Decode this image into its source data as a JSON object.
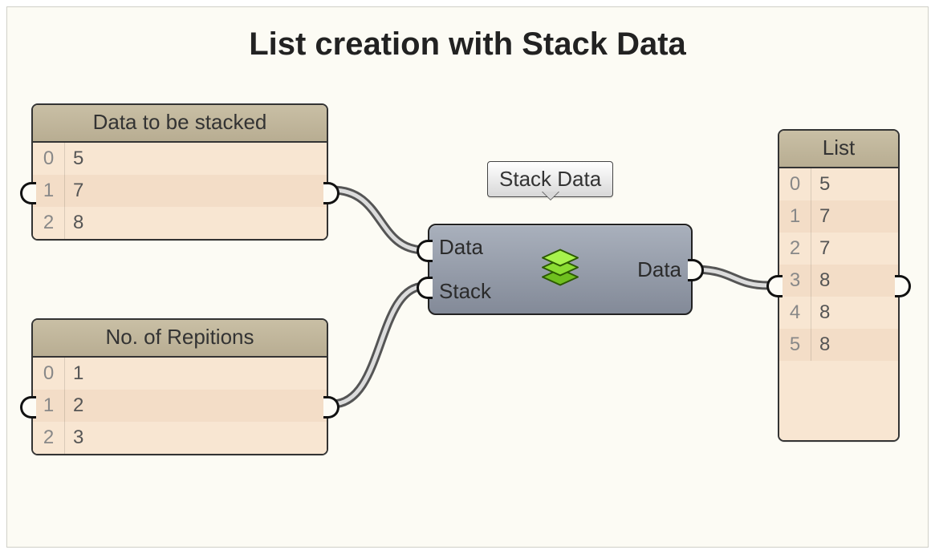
{
  "title": "List creation with Stack Data",
  "panels": {
    "data": {
      "title": "Data to be stacked",
      "rows": [
        {
          "idx": "0",
          "val": "5"
        },
        {
          "idx": "1",
          "val": "7"
        },
        {
          "idx": "2",
          "val": "8"
        }
      ]
    },
    "reps": {
      "title": "No. of Repitions",
      "rows": [
        {
          "idx": "0",
          "val": "1"
        },
        {
          "idx": "1",
          "val": "2"
        },
        {
          "idx": "2",
          "val": "3"
        }
      ]
    },
    "list": {
      "title": "List",
      "rows": [
        {
          "idx": "0",
          "val": "5"
        },
        {
          "idx": "1",
          "val": "7"
        },
        {
          "idx": "2",
          "val": "7"
        },
        {
          "idx": "3",
          "val": "8"
        },
        {
          "idx": "4",
          "val": "8"
        },
        {
          "idx": "5",
          "val": "8"
        }
      ]
    }
  },
  "component": {
    "tooltip": "Stack Data",
    "inputs": [
      "Data",
      "Stack"
    ],
    "outputs": [
      "Data"
    ]
  }
}
